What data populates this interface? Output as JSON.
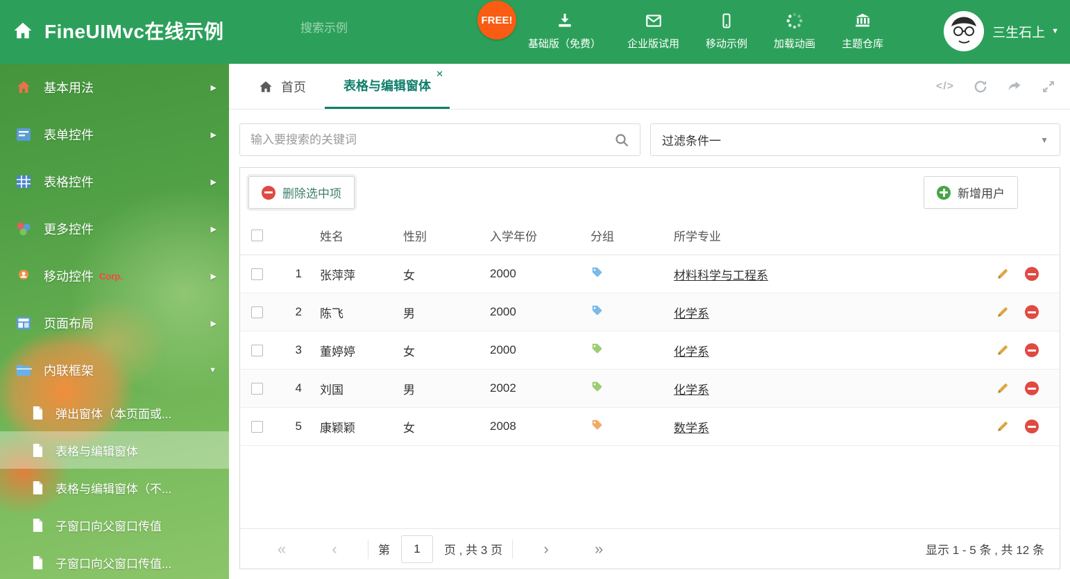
{
  "colors": {
    "header_green": "#2ca05a",
    "accent_teal": "#0f7e6a",
    "free_badge": "#f95c12",
    "delete_red": "#e04a42",
    "add_green": "#46a546",
    "pencil_orange": "#e0a63f"
  },
  "header": {
    "title": "FineUIMvc在线示例",
    "search_placeholder": "搜索示例",
    "free_badge": "FREE!",
    "nav": [
      {
        "label": "基础版（免费）"
      },
      {
        "label": "企业版试用"
      },
      {
        "label": "移动示例"
      },
      {
        "label": "加载动画"
      },
      {
        "label": "主题仓库"
      }
    ],
    "user_name": "三生石上"
  },
  "sidebar": {
    "items": [
      {
        "label": "基本用法"
      },
      {
        "label": "表单控件"
      },
      {
        "label": "表格控件"
      },
      {
        "label": "更多控件"
      },
      {
        "label": "移动控件",
        "badge": "Corp."
      },
      {
        "label": "页面布局"
      },
      {
        "label": "内联框架"
      }
    ],
    "children": [
      {
        "label": "弹出窗体（本页面或..."
      },
      {
        "label": "表格与编辑窗体"
      },
      {
        "label": "表格与编辑窗体（不..."
      },
      {
        "label": "子窗口向父窗口传值"
      },
      {
        "label": "子窗口向父窗口传值..."
      }
    ]
  },
  "tabs": {
    "home_label": "首页",
    "active_label": "表格与编辑窗体",
    "close_glyph": "✕"
  },
  "filters": {
    "search_placeholder": "输入要搜索的关键词",
    "dropdown_value": "过滤条件一"
  },
  "toolbar": {
    "delete_label": "删除选中项",
    "add_label": "新增用户"
  },
  "table": {
    "columns": {
      "name": "姓名",
      "gender": "性别",
      "year": "入学年份",
      "group": "分组",
      "major": "所学专业"
    },
    "rows": [
      {
        "num": "1",
        "name": "张萍萍",
        "gender": "女",
        "year": "2000",
        "tag_color": "#7cb9e8",
        "major": "材料科学与工程系"
      },
      {
        "num": "2",
        "name": "陈飞",
        "gender": "男",
        "year": "2000",
        "tag_color": "#7cb9e8",
        "major": "化学系"
      },
      {
        "num": "3",
        "name": "董婷婷",
        "gender": "女",
        "year": "2000",
        "tag_color": "#9ccd72",
        "major": "化学系"
      },
      {
        "num": "4",
        "name": "刘国",
        "gender": "男",
        "year": "2002",
        "tag_color": "#9ccd72",
        "major": "化学系"
      },
      {
        "num": "5",
        "name": "康颖颖",
        "gender": "女",
        "year": "2008",
        "tag_color": "#f2aa68",
        "major": "数学系"
      }
    ]
  },
  "pagination": {
    "first": "«",
    "prev": "‹",
    "next": "›",
    "last": "»",
    "page_prefix": "第",
    "current_page": "1",
    "page_suffix": "页 , 共 3 页",
    "summary": "显示 1 - 5 条 , 共 12 条"
  }
}
